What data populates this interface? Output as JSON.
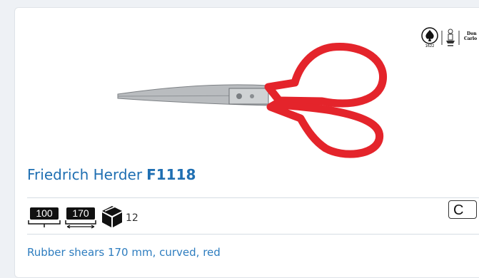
{
  "product": {
    "brand": "Friedrich Herder",
    "code": "F1118",
    "description": "Rubber shears 170 mm, curved, red",
    "handle_color": "#e4242b",
    "blade_color": "#b9bcbf"
  },
  "specs": {
    "cutting_length": "100",
    "total_length": "170",
    "package_qty": "12"
  },
  "logos": {
    "spade_year": "1622",
    "label_top": "Don",
    "label_bottom": "Carlo"
  },
  "action_button": {
    "label": "C"
  },
  "colors": {
    "accent": "#1f6fb2",
    "divider": "#d6dde3",
    "background": "#eef1f5"
  }
}
